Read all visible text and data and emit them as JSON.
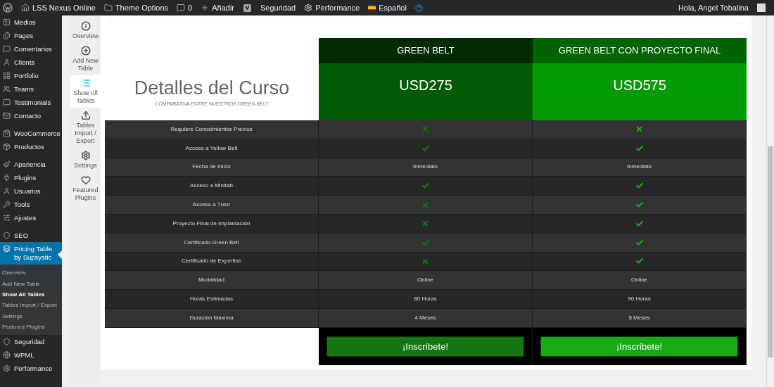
{
  "admin_bar": {
    "site": "LSS Nexus Online",
    "theme_options": "Theme Options",
    "comments": "0",
    "add_new": "Añadir",
    "security": "Seguridad",
    "performance": "Performance",
    "language": "Español",
    "greeting": "Hola, Angel Tobalina"
  },
  "admin_menu": [
    [
      {
        "label": "Medios"
      },
      {
        "label": "Pages"
      },
      {
        "label": "Comentarios"
      },
      {
        "label": "Clients"
      },
      {
        "label": "Portfolio"
      },
      {
        "label": "Teams"
      },
      {
        "label": "Testimonials"
      },
      {
        "label": "Contacto"
      }
    ],
    [
      {
        "label": "WooCommerce"
      },
      {
        "label": "Productos"
      }
    ],
    [
      {
        "label": "Apariencia"
      },
      {
        "label": "Plugins"
      },
      {
        "label": "Usuarios"
      },
      {
        "label": "Tools"
      },
      {
        "label": "Ajustes"
      }
    ],
    [
      {
        "label": "SEO",
        "selected": false
      },
      {
        "label": "Pricing Table by Supsystic",
        "selected": true,
        "children": [
          {
            "label": "Overview",
            "selected": false
          },
          {
            "label": "Add New Table",
            "selected": false
          },
          {
            "label": "Show All Tables",
            "selected": true
          },
          {
            "label": "Tables Import / Export",
            "selected": false
          },
          {
            "label": "Settings",
            "selected": false
          },
          {
            "label": "Featured Plugins",
            "selected": false
          }
        ]
      },
      {
        "label": "Seguridad",
        "selected": false
      },
      {
        "label": "WPML",
        "selected": false
      },
      {
        "label": "Performance",
        "selected": false
      }
    ]
  ],
  "plugin_nav": [
    {
      "label": "Overview",
      "selected": false
    },
    {
      "label": "Add New Table",
      "selected": false
    },
    {
      "label": "Show All Tables",
      "selected": true
    },
    {
      "label": "Tables Import / Export",
      "selected": false
    },
    {
      "label": "Settings",
      "selected": false
    },
    {
      "label": "Featured Plugins",
      "selected": false
    }
  ],
  "pricing_table": {
    "title": "Detalles del Curso",
    "subtitle": "COMPARATIVA ENTRE NUESTROS GREEN BELT",
    "plans": [
      {
        "name": "GREEN BELT",
        "price": "USD275",
        "button": "¡Inscríbete!",
        "color": "#015a01"
      },
      {
        "name": "GREEN BELT CON PROYECTO FINAL",
        "price": "USD575",
        "button": "¡Inscríbete!",
        "color": "#039a03"
      }
    ],
    "features": [
      {
        "label": "Requiere Conocimientos Previos",
        "cells": [
          {
            "kind": "cross"
          },
          {
            "kind": "cross"
          }
        ]
      },
      {
        "label": "Acceso a Yellow Belt",
        "cells": [
          {
            "kind": "check"
          },
          {
            "kind": "check"
          }
        ]
      },
      {
        "label": "Fecha de Inicio",
        "cells": [
          {
            "kind": "text",
            "text": "Inmediato"
          },
          {
            "kind": "text",
            "text": "Inmediato"
          }
        ]
      },
      {
        "label": "Acceso a Minitab",
        "cells": [
          {
            "kind": "check"
          },
          {
            "kind": "check"
          }
        ]
      },
      {
        "label": "Acceso a Tutor",
        "cells": [
          {
            "kind": "cross"
          },
          {
            "kind": "check"
          }
        ]
      },
      {
        "label": "Proyecto Final de Implantación",
        "cells": [
          {
            "kind": "cross"
          },
          {
            "kind": "check"
          }
        ]
      },
      {
        "label": "Certificado Green Belt",
        "cells": [
          {
            "kind": "check"
          },
          {
            "kind": "check"
          }
        ]
      },
      {
        "label": "Certificado de Expertise",
        "cells": [
          {
            "kind": "cross"
          },
          {
            "kind": "check"
          }
        ]
      },
      {
        "label": "Modalidad",
        "cells": [
          {
            "kind": "text",
            "text": "Online"
          },
          {
            "kind": "text",
            "text": "Online"
          }
        ]
      },
      {
        "label": "Horas Estimadas",
        "cells": [
          {
            "kind": "text",
            "text": "80 Horas"
          },
          {
            "kind": "text",
            "text": "90 Horas"
          }
        ]
      },
      {
        "label": "Duración Máxima",
        "cells": [
          {
            "kind": "text",
            "text": "4 Meses"
          },
          {
            "kind": "text",
            "text": "5 Meses"
          }
        ]
      }
    ]
  }
}
